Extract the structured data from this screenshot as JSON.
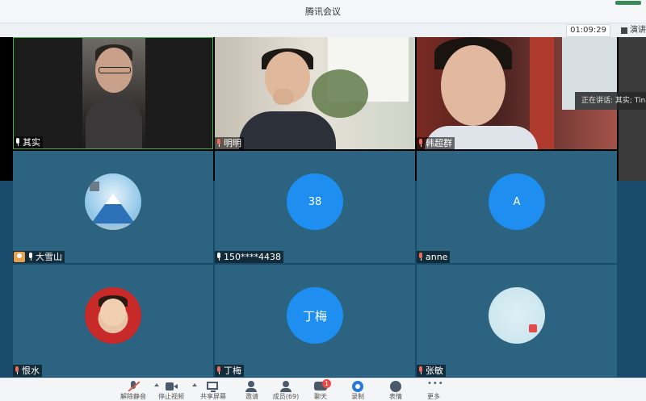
{
  "window": {
    "title": "腾讯会议"
  },
  "topbar": {
    "timer": "01:09:29",
    "present_label": "演讲"
  },
  "speaking": {
    "text": "正在讲话: 其实; Tina;"
  },
  "participants": [
    {
      "name": "其实",
      "mic": "on"
    },
    {
      "name": "明明",
      "mic": "off"
    },
    {
      "name": "韩超群",
      "mic": "off"
    },
    {
      "name": "大雪山",
      "mic": "on",
      "host": true
    },
    {
      "name": "150****4438",
      "mic": "on",
      "avatar_text": "38"
    },
    {
      "name": "anne",
      "mic": "off",
      "avatar_text": "A"
    },
    {
      "name": "恨水",
      "mic": "off"
    },
    {
      "name": "丁梅",
      "mic": "off",
      "avatar_text": "丁梅"
    },
    {
      "name": "张敏",
      "mic": "off"
    }
  ],
  "toolbar": {
    "items": [
      {
        "label": "解除静音",
        "icon": "mic-off-icon"
      },
      {
        "label": "停止视频",
        "icon": "camera-icon"
      },
      {
        "label": "共享屏幕",
        "icon": "share-screen-icon"
      },
      {
        "label": "邀请",
        "icon": "invite-icon"
      },
      {
        "label": "成员(69)",
        "icon": "members-icon"
      },
      {
        "label": "聊天",
        "icon": "chat-icon",
        "badge": "1"
      },
      {
        "label": "录制",
        "icon": "record-icon"
      },
      {
        "label": "表情",
        "icon": "emoji-icon"
      },
      {
        "label": "更多",
        "icon": "more-icon"
      }
    ]
  },
  "colors": {
    "tile_blue": "#2b6380",
    "avatar_blue": "#1e8ff0",
    "active_border": "#4caf50",
    "badge_red": "#f04848"
  }
}
